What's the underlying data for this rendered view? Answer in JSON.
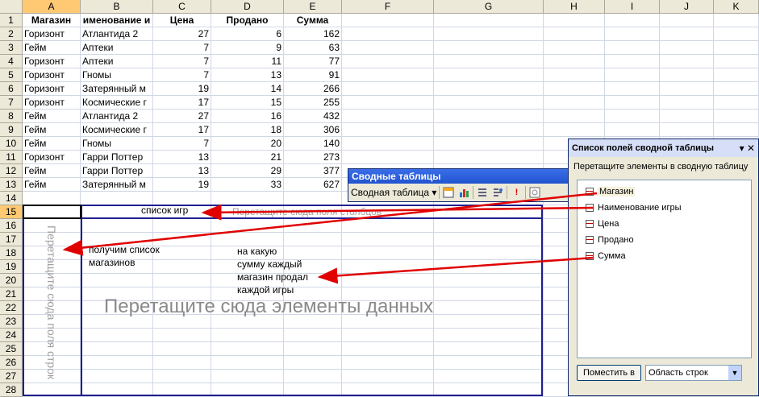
{
  "columns": [
    "A",
    "B",
    "C",
    "D",
    "E",
    "F",
    "G",
    "H",
    "I",
    "J",
    "K"
  ],
  "rows": [
    "1",
    "2",
    "3",
    "4",
    "5",
    "6",
    "7",
    "8",
    "9",
    "10",
    "11",
    "12",
    "13",
    "14",
    "15",
    "16",
    "17",
    "18",
    "19",
    "20",
    "21",
    "22",
    "23",
    "24",
    "25",
    "26",
    "27",
    "28"
  ],
  "table": {
    "headers": [
      "Магазин",
      "именование и",
      "Цена",
      "Продано",
      "Сумма"
    ],
    "data": [
      [
        "Горизонт",
        "Атлантида 2",
        "27",
        "6",
        "162"
      ],
      [
        "Гейм",
        "Аптеки",
        "7",
        "9",
        "63"
      ],
      [
        "Горизонт",
        "Аптеки",
        "7",
        "11",
        "77"
      ],
      [
        "Горизонт",
        "Гномы",
        "7",
        "13",
        "91"
      ],
      [
        "Горизонт",
        "Затерянный м",
        "19",
        "14",
        "266"
      ],
      [
        "Горизонт",
        "Космические г",
        "17",
        "15",
        "255"
      ],
      [
        "Гейм",
        "Атлантида 2",
        "27",
        "16",
        "432"
      ],
      [
        "Гейм",
        "Космические г",
        "17",
        "18",
        "306"
      ],
      [
        "Гейм",
        "Гномы",
        "7",
        "20",
        "140"
      ],
      [
        "Горизонт",
        "Гарри Поттер",
        "13",
        "21",
        "273"
      ],
      [
        "Гейм",
        "Гарри Поттер",
        "13",
        "29",
        "377"
      ],
      [
        "Гейм",
        "Затерянный м",
        "19",
        "33",
        "627"
      ]
    ]
  },
  "pivot": {
    "column_hint": "Перетащите сюда поля столбцов",
    "row_hint": "Перетащите сюда поля строк",
    "data_hint": "Перетащите сюда элементы данных",
    "note_games": "список игр",
    "note_stores": [
      "получим список",
      "магазинов"
    ],
    "note_sums": [
      "на какую",
      "сумму каждый",
      "магазин продал",
      "каждой игры"
    ]
  },
  "pivot_toolbar": {
    "title": "Сводные таблицы",
    "menu_label": "Сводная таблица"
  },
  "field_list": {
    "title": "Список полей сводной таблицы",
    "instruction": "Перетащите элементы в сводную таблицу",
    "fields": [
      "Магазин",
      "Наименование игры",
      "Цена",
      "Продано",
      "Сумма"
    ],
    "button": "Поместить в",
    "area_select": "Область строк"
  }
}
